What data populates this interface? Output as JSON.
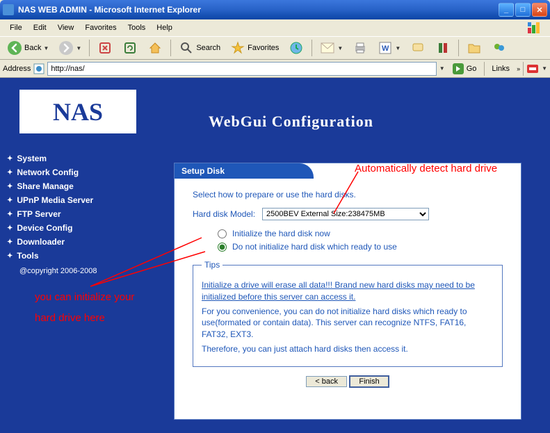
{
  "window": {
    "title": "NAS WEB ADMIN - Microsoft Internet Explorer"
  },
  "menubar": {
    "file": "File",
    "edit": "Edit",
    "view": "View",
    "favorites": "Favorites",
    "tools": "Tools",
    "help": "Help"
  },
  "toolbar": {
    "back": "Back",
    "search": "Search",
    "favorites": "Favorites"
  },
  "addressbar": {
    "label": "Address",
    "url": "http://nas/",
    "go": "Go",
    "links": "Links"
  },
  "header": {
    "logo": "NAS",
    "title": "WebGui   Configuration"
  },
  "sidebar": {
    "items": [
      {
        "label": "System"
      },
      {
        "label": "Network Config"
      },
      {
        "label": "Share Manage"
      },
      {
        "label": "UPnP Media Server"
      },
      {
        "label": "FTP Server"
      },
      {
        "label": "Device Config"
      },
      {
        "label": "Downloader"
      },
      {
        "label": "Tools"
      }
    ],
    "copyright": "@copyright 2006-2008"
  },
  "panel": {
    "title": "Setup Disk",
    "intro": "Select how to prepare or use the hard disks.",
    "model_label": "Hard disk Model:",
    "model_value": "2500BEV External      Size:238475MB",
    "radio1": "Initialize the hard disk now",
    "radio2": "Do not initialize hard disk which ready to use",
    "tips_legend": "Tips",
    "tips_p1": "Initialize a drive will erase all data!!! Brand new hard disks may need to be initialized before this server can access it.",
    "tips_p2": "For you convenience, you can do not initialize hard disks which ready to use(formated or contain data). This server can recognize NTFS, FAT16, FAT32, EXT3.",
    "tips_p3": "Therefore, you can just attach hard disks then access it.",
    "back_btn": "< back",
    "finish_btn": "Finish"
  },
  "annotations": {
    "a1": "Automatically detect hard drive",
    "a2": "you can initialize your",
    "a3": "hard drive here"
  }
}
